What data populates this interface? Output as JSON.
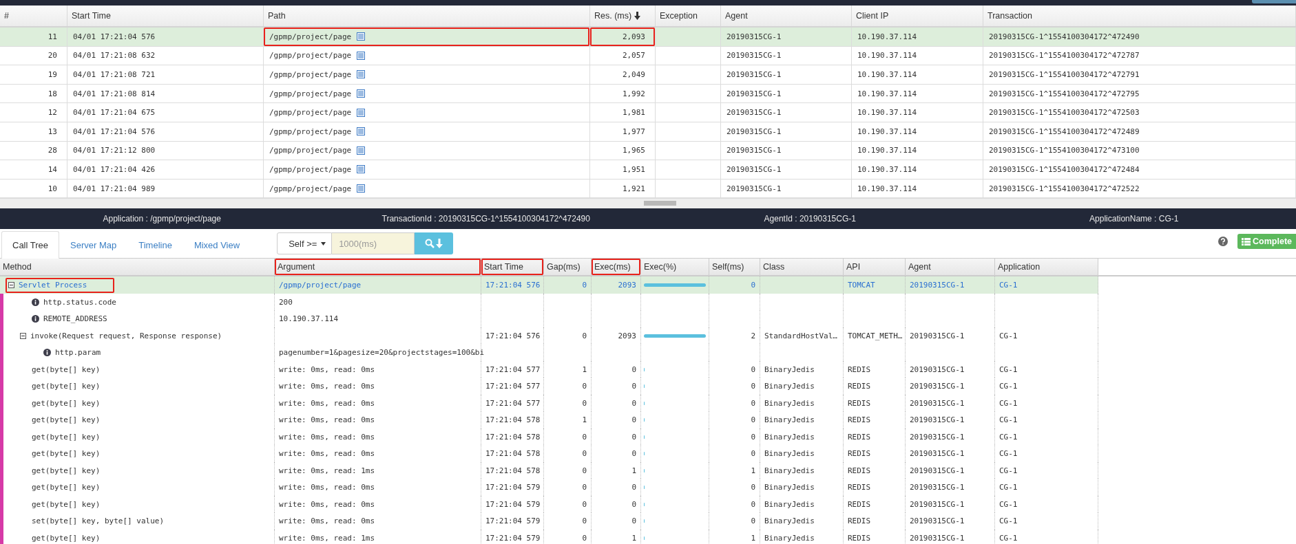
{
  "top_table": {
    "columns": [
      {
        "label": "#",
        "sorted": false
      },
      {
        "label": "Start Time",
        "sorted": false
      },
      {
        "label": "Path",
        "sorted": false
      },
      {
        "label": "Res. (ms)",
        "sorted": true
      },
      {
        "label": "Exception",
        "sorted": false
      },
      {
        "label": "Agent",
        "sorted": false
      },
      {
        "label": "Client IP",
        "sorted": false
      },
      {
        "label": "Transaction",
        "sorted": false
      }
    ],
    "rows": [
      {
        "selected": true,
        "path_marked": true,
        "res_marked": true,
        "num": "11",
        "start_time": "04/01 17:21:04 576",
        "path": "/gpmp/project/page",
        "res_ms": "2,093",
        "agent": "20190315CG-1",
        "client_ip": "10.190.37.114",
        "transaction": "20190315CG-1^1554100304172^472490"
      },
      {
        "selected": false,
        "path_marked": false,
        "res_marked": false,
        "num": "20",
        "start_time": "04/01 17:21:08 632",
        "path": "/gpmp/project/page",
        "res_ms": "2,057",
        "agent": "20190315CG-1",
        "client_ip": "10.190.37.114",
        "transaction": "20190315CG-1^1554100304172^472787"
      },
      {
        "selected": false,
        "path_marked": false,
        "res_marked": false,
        "num": "19",
        "start_time": "04/01 17:21:08 721",
        "path": "/gpmp/project/page",
        "res_ms": "2,049",
        "agent": "20190315CG-1",
        "client_ip": "10.190.37.114",
        "transaction": "20190315CG-1^1554100304172^472791"
      },
      {
        "selected": false,
        "path_marked": false,
        "res_marked": false,
        "num": "18",
        "start_time": "04/01 17:21:08 814",
        "path": "/gpmp/project/page",
        "res_ms": "1,992",
        "agent": "20190315CG-1",
        "client_ip": "10.190.37.114",
        "transaction": "20190315CG-1^1554100304172^472795"
      },
      {
        "selected": false,
        "path_marked": false,
        "res_marked": false,
        "num": "12",
        "start_time": "04/01 17:21:04 675",
        "path": "/gpmp/project/page",
        "res_ms": "1,981",
        "agent": "20190315CG-1",
        "client_ip": "10.190.37.114",
        "transaction": "20190315CG-1^1554100304172^472503"
      },
      {
        "selected": false,
        "path_marked": false,
        "res_marked": false,
        "num": "13",
        "start_time": "04/01 17:21:04 576",
        "path": "/gpmp/project/page",
        "res_ms": "1,977",
        "agent": "20190315CG-1",
        "client_ip": "10.190.37.114",
        "transaction": "20190315CG-1^1554100304172^472489"
      },
      {
        "selected": false,
        "path_marked": false,
        "res_marked": false,
        "num": "28",
        "start_time": "04/01 17:21:12 800",
        "path": "/gpmp/project/page",
        "res_ms": "1,965",
        "agent": "20190315CG-1",
        "client_ip": "10.190.37.114",
        "transaction": "20190315CG-1^1554100304172^473100"
      },
      {
        "selected": false,
        "path_marked": false,
        "res_marked": false,
        "num": "14",
        "start_time": "04/01 17:21:04 426",
        "path": "/gpmp/project/page",
        "res_ms": "1,951",
        "agent": "20190315CG-1",
        "client_ip": "10.190.37.114",
        "transaction": "20190315CG-1^1554100304172^472484"
      },
      {
        "selected": false,
        "path_marked": false,
        "res_marked": false,
        "num": "10",
        "start_time": "04/01 17:21:04 989",
        "path": "/gpmp/project/page",
        "res_ms": "1,921",
        "agent": "20190315CG-1",
        "client_ip": "10.190.37.114",
        "transaction": "20190315CG-1^1554100304172^472522"
      }
    ]
  },
  "info_bar": [
    "Application : /gpmp/project/page",
    "TransactionId : 20190315CG-1^1554100304172^472490",
    "AgentId : 20190315CG-1",
    "ApplicationName : CG-1"
  ],
  "tabs": [
    {
      "label": "Call Tree",
      "selected": true
    },
    {
      "label": "Server Map",
      "selected": false
    },
    {
      "label": "Timeline",
      "selected": false
    },
    {
      "label": "Mixed View",
      "selected": false
    }
  ],
  "filter": {
    "select": "Self >=",
    "placeholder": "1000(ms)"
  },
  "complete_button": "Complete",
  "call_tree": {
    "columns": [
      {
        "label": "Method",
        "marked": false
      },
      {
        "label": "Argument",
        "marked": true
      },
      {
        "label": "Start Time",
        "marked": true
      },
      {
        "label": "Gap(ms)",
        "marked": false
      },
      {
        "label": "Exec(ms)",
        "marked": true
      },
      {
        "label": "Exec(%)",
        "marked": false
      },
      {
        "label": "Self(ms)",
        "marked": false
      },
      {
        "label": "Class",
        "marked": false
      },
      {
        "label": "API",
        "marked": false
      },
      {
        "label": "Agent",
        "marked": false
      },
      {
        "label": "Application",
        "marked": false
      }
    ],
    "rows": [
      {
        "kind": "method",
        "selected": true,
        "marked": true,
        "expanded": true,
        "method": "Servlet Process",
        "argument": "/gpmp/project/page",
        "start_time": "17:21:04 576",
        "gap_ms": "0",
        "exec_ms": "2093",
        "level": 1,
        "self_ms": "0",
        "api": "TOMCAT",
        "agent": "20190315CG-1",
        "application": "CG-1",
        "children": [
          {
            "kind": "param",
            "selected": false,
            "method": "http.status.code",
            "argument": "200"
          },
          {
            "kind": "param",
            "selected": false,
            "method": "REMOTE_ADDRESS",
            "argument": "10.190.37.114"
          },
          {
            "kind": "method",
            "selected": false,
            "expanded": true,
            "method": "invoke(Request request, Response response)",
            "start_time": "17:21:04 576",
            "gap_ms": "0",
            "exec_ms": "2093",
            "level": 1,
            "self_ms": "2",
            "class": "StandardHostVal…",
            "api": "TOMCAT_METH…",
            "agent": "20190315CG-1",
            "application": "CG-1",
            "children": [
              {
                "kind": "param",
                "selected": false,
                "method": "http.param",
                "argument": "pagenumber=1&pagesize=20&projectstages=100&bi"
              },
              {
                "kind": "method",
                "selected": false,
                "method": "get(byte[] key)",
                "argument": "write: 0ms, read: 0ms",
                "start_time": "17:21:04 577",
                "gap_ms": "1",
                "exec_ms": "0",
                "level": 0,
                "self_ms": "0",
                "class": "BinaryJedis",
                "api": "REDIS",
                "agent": "20190315CG-1",
                "application": "CG-1"
              },
              {
                "kind": "method",
                "selected": false,
                "method": "get(byte[] key)",
                "argument": "write: 0ms, read: 0ms",
                "start_time": "17:21:04 577",
                "gap_ms": "0",
                "exec_ms": "0",
                "level": 0,
                "self_ms": "0",
                "class": "BinaryJedis",
                "api": "REDIS",
                "agent": "20190315CG-1",
                "application": "CG-1"
              },
              {
                "kind": "method",
                "selected": false,
                "method": "get(byte[] key)",
                "argument": "write: 0ms, read: 0ms",
                "start_time": "17:21:04 577",
                "gap_ms": "0",
                "exec_ms": "0",
                "level": 0,
                "self_ms": "0",
                "class": "BinaryJedis",
                "api": "REDIS",
                "agent": "20190315CG-1",
                "application": "CG-1"
              },
              {
                "kind": "method",
                "selected": false,
                "method": "get(byte[] key)",
                "argument": "write: 0ms, read: 0ms",
                "start_time": "17:21:04 578",
                "gap_ms": "1",
                "exec_ms": "0",
                "level": 0,
                "self_ms": "0",
                "class": "BinaryJedis",
                "api": "REDIS",
                "agent": "20190315CG-1",
                "application": "CG-1"
              },
              {
                "kind": "method",
                "selected": false,
                "method": "get(byte[] key)",
                "argument": "write: 0ms, read: 0ms",
                "start_time": "17:21:04 578",
                "gap_ms": "0",
                "exec_ms": "0",
                "level": 0,
                "self_ms": "0",
                "class": "BinaryJedis",
                "api": "REDIS",
                "agent": "20190315CG-1",
                "application": "CG-1"
              },
              {
                "kind": "method",
                "selected": false,
                "method": "get(byte[] key)",
                "argument": "write: 0ms, read: 0ms",
                "start_time": "17:21:04 578",
                "gap_ms": "0",
                "exec_ms": "0",
                "level": 0,
                "self_ms": "0",
                "class": "BinaryJedis",
                "api": "REDIS",
                "agent": "20190315CG-1",
                "application": "CG-1"
              },
              {
                "kind": "method",
                "selected": false,
                "method": "get(byte[] key)",
                "argument": "write: 0ms, read: 1ms",
                "start_time": "17:21:04 578",
                "gap_ms": "0",
                "exec_ms": "1",
                "level": 0.0005,
                "self_ms": "1",
                "class": "BinaryJedis",
                "api": "REDIS",
                "agent": "20190315CG-1",
                "application": "CG-1"
              },
              {
                "kind": "method",
                "selected": false,
                "method": "get(byte[] key)",
                "argument": "write: 0ms, read: 0ms",
                "start_time": "17:21:04 579",
                "gap_ms": "0",
                "exec_ms": "0",
                "level": 0,
                "self_ms": "0",
                "class": "BinaryJedis",
                "api": "REDIS",
                "agent": "20190315CG-1",
                "application": "CG-1"
              },
              {
                "kind": "method",
                "selected": false,
                "method": "get(byte[] key)",
                "argument": "write: 0ms, read: 0ms",
                "start_time": "17:21:04 579",
                "gap_ms": "0",
                "exec_ms": "0",
                "level": 0,
                "self_ms": "0",
                "class": "BinaryJedis",
                "api": "REDIS",
                "agent": "20190315CG-1",
                "application": "CG-1"
              },
              {
                "kind": "method",
                "selected": false,
                "method": "set(byte[] key, byte[] value)",
                "argument": "write: 0ms, read: 0ms",
                "start_time": "17:21:04 579",
                "gap_ms": "0",
                "exec_ms": "0",
                "level": 0,
                "self_ms": "0",
                "class": "BinaryJedis",
                "api": "REDIS",
                "agent": "20190315CG-1",
                "application": "CG-1"
              },
              {
                "kind": "method",
                "selected": false,
                "method": "get(byte[] key)",
                "argument": "write: 0ms, read: 1ms",
                "start_time": "17:21:04 579",
                "gap_ms": "0",
                "exec_ms": "1",
                "level": 0.0005,
                "self_ms": "1",
                "class": "BinaryJedis",
                "api": "REDIS",
                "agent": "20190315CG-1",
                "application": "CG-1"
              }
            ]
          }
        ]
      }
    ]
  }
}
